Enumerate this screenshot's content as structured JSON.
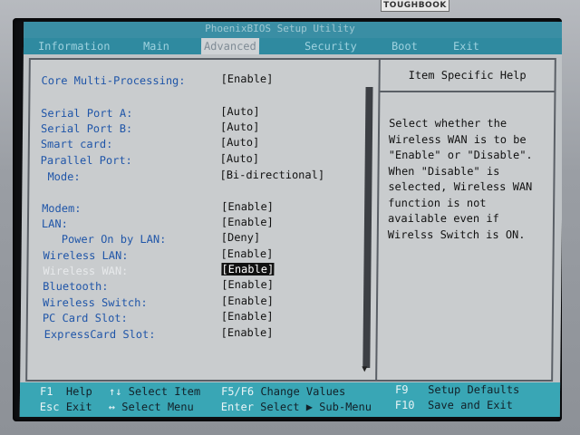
{
  "bezel": {
    "brand": "TOUGHBOOK"
  },
  "bios": {
    "title": "PhoenixBIOS Setup Utility",
    "menu": [
      "Information",
      "Main",
      "Advanced",
      "Security",
      "Boot",
      "Exit"
    ],
    "active_menu": "Advanced",
    "settings": [
      {
        "label": "Core Multi-Processing:",
        "value": "[Enable]"
      },
      {
        "label": "Serial Port A:",
        "value": "[Auto]"
      },
      {
        "label": "Serial Port B:",
        "value": "[Auto]"
      },
      {
        "label": "Smart card:",
        "value": "[Auto]"
      },
      {
        "label": "Parallel Port:",
        "value": "[Auto]"
      },
      {
        "label": "Mode:",
        "value": "[Bi-directional]"
      },
      {
        "label": "Modem:",
        "value": "[Enable]"
      },
      {
        "label": "LAN:",
        "value": "[Enable]"
      },
      {
        "label": "Power On by LAN:",
        "value": "[Deny]"
      },
      {
        "label": "Wireless LAN:",
        "value": "[Enable]"
      },
      {
        "label": "Wireless WAN:",
        "value": "[Enable]",
        "selected": true
      },
      {
        "label": "Bluetooth:",
        "value": "[Enable]"
      },
      {
        "label": "Wireless Switch:",
        "value": "[Enable]"
      },
      {
        "label": "PC Card Slot:",
        "value": "[Enable]"
      },
      {
        "label": "ExpressCard Slot:",
        "value": "[Enable]"
      }
    ],
    "help_title": "Item Specific Help",
    "help_text": "Select whether the\nWireless WAN is to be\n\"Enable\" or \"Disable\".\nWhen \"Disable\" is\nselected, Wireless WAN\nfunction is not\navailable even if\nWirelss Switch is ON.",
    "keys": {
      "f1": {
        "key": "F1",
        "desc": "Help"
      },
      "updown": {
        "key": "↑↓",
        "desc": "Select Item"
      },
      "f5f6": {
        "key": "F5/F6",
        "desc": "Change Values"
      },
      "f9": {
        "key": "F9",
        "desc": "Setup Defaults"
      },
      "esc": {
        "key": "Esc",
        "desc": "Exit"
      },
      "leftright": {
        "key": "↔",
        "desc": "Select Menu"
      },
      "enter": {
        "key": "Enter",
        "desc": "Select ▶ Sub-Menu"
      },
      "f10": {
        "key": "F10",
        "desc": "Save and Exit"
      }
    }
  }
}
